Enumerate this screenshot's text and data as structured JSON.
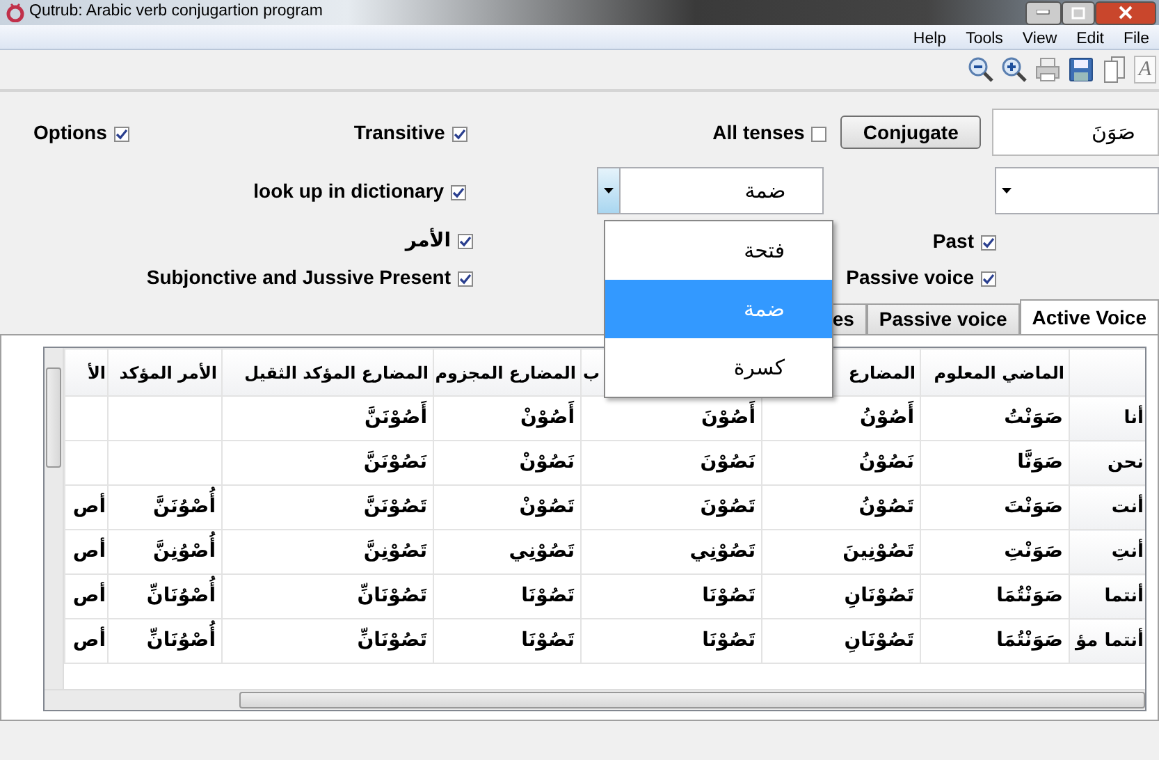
{
  "window": {
    "title": "Qutrub: Arabic verb conjugartion program"
  },
  "menu": [
    "File",
    "Edit",
    "View",
    "Tools",
    "Help"
  ],
  "toolbar": {
    "font_button": "A"
  },
  "options": {
    "label": "Options",
    "checked": true
  },
  "transitive": {
    "label": "Transitive",
    "checked": true
  },
  "all_tenses": {
    "label": "All tenses",
    "checked": false
  },
  "conjugate_button": "Conjugate",
  "verb_input": {
    "value": "صَوَنَ"
  },
  "dictionary": {
    "label": "look up in dictionary",
    "checked": true
  },
  "haraka_dropdown": {
    "value": "ضمة",
    "expanded": true,
    "options": [
      {
        "label": "فتحة",
        "selected": false
      },
      {
        "label": "ضمة",
        "selected": true
      },
      {
        "label": "كسرة",
        "selected": false
      }
    ]
  },
  "imperative": {
    "label": "الأمر",
    "checked": true
  },
  "past": {
    "label": "Past",
    "checked": true
  },
  "subjunctive": {
    "label": "Subjonctive and Jussive Present",
    "checked": true
  },
  "passive": {
    "label": "Passive voice",
    "checked": true
  },
  "tabs": [
    {
      "label": "Active Voice",
      "selected": true
    },
    {
      "label": "Passive voice",
      "selected": false
    },
    {
      "label": "es",
      "selected": false
    }
  ],
  "table": {
    "columns": [
      "الماضي المعلوم",
      "المضارع",
      "ب",
      "المضارع المجزوم",
      "المضارع المؤكد الثقيل",
      "الأمر المؤكد",
      "الأ"
    ],
    "rows": [
      {
        "pronoun": "أنا",
        "cells": [
          "صَوَنْتُ",
          "أَصُوْنُ",
          "أَصُوْنَ",
          "أَصُوْنْ",
          "أَصُوْنَنَّ",
          "",
          ""
        ]
      },
      {
        "pronoun": "نحن",
        "cells": [
          "صَوَنَّا",
          "نَصُوْنُ",
          "نَصُوْنَ",
          "نَصُوْنْ",
          "نَصُوْنَنَّ",
          "",
          ""
        ]
      },
      {
        "pronoun": "أنت",
        "cells": [
          "صَوَنْتَ",
          "تَصُوْنُ",
          "تَصُوْنَ",
          "تَصُوْنْ",
          "تَصُوْنَنَّ",
          "أُصْوُنَنَّ",
          "أص"
        ]
      },
      {
        "pronoun": "أنتِ",
        "cells": [
          "صَوَنْتِ",
          "تَصُوْنِينَ",
          "تَصُوْنِي",
          "تَصُوْنِي",
          "تَصُوْنِنَّ",
          "أُصْوُنِنَّ",
          "أص"
        ]
      },
      {
        "pronoun": "أنتما",
        "cells": [
          "صَوَنْتُمَا",
          "تَصُوْنَانِ",
          "تَصُوْنَا",
          "تَصُوْنَا",
          "تَصُوْنَانِّ",
          "أُصْوُنَانِّ",
          "أص"
        ]
      },
      {
        "pronoun": "أنتما مؤ",
        "cells": [
          "صَوَنْتُمَا",
          "تَصُوْنَانِ",
          "تَصُوْنَا",
          "تَصُوْنَا",
          "تَصُوْنَانِّ",
          "أُصْوُنَانِّ",
          "أص"
        ]
      }
    ]
  }
}
